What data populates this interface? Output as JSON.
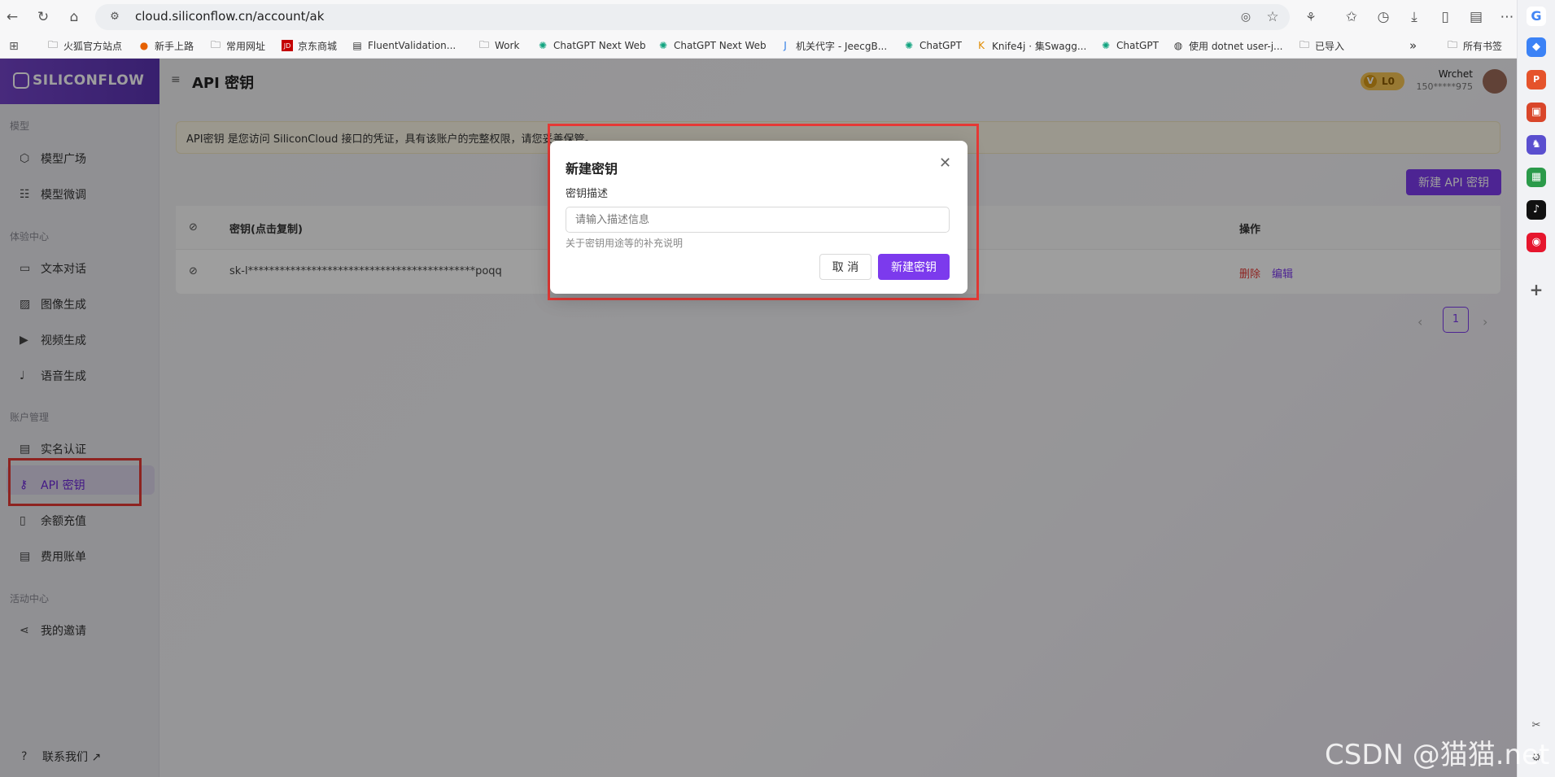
{
  "browser": {
    "url": "cloud.siliconflow.cn/account/ak",
    "bookmarks": [
      "火狐官方站点",
      "新手上路",
      "常用网址",
      "京东商城",
      "FluentValidation...",
      "Work",
      "ChatGPT Next Web",
      "ChatGPT Next Web",
      "机关代字 - JeecgB...",
      "ChatGPT",
      "Knife4j · 集Swagg...",
      "ChatGPT",
      "使用 dotnet user-j...",
      "已导入"
    ],
    "all_bookmarks": "所有书签",
    "more": "»"
  },
  "app": {
    "logo": "SILICONFLOW",
    "page_title": "API 密钥",
    "level_badge": "L0",
    "level_prefix": "V",
    "user_name": "Wrchet",
    "user_phone": "150*****975",
    "notice": "API密钥 是您访问 SiliconCloud 接口的凭证，具有该账户的完整权限，请您妥善保管。",
    "new_key_button": "新建 API 密钥",
    "table": {
      "col_key": "密钥(点击复制)",
      "col_ops": "操作",
      "row_key": "sk-l*******************************************poqq",
      "delete": "删除",
      "edit": "编辑"
    },
    "pagination": {
      "current": "1",
      "prev": "‹",
      "next": "›"
    },
    "sidebar": {
      "groups": [
        {
          "label": "模型",
          "items": [
            {
              "label": "模型广场",
              "icon": "cube-icon"
            },
            {
              "label": "模型微调",
              "icon": "sliders-icon"
            }
          ]
        },
        {
          "label": "体验中心",
          "items": [
            {
              "label": "文本对话",
              "icon": "chat-icon"
            },
            {
              "label": "图像生成",
              "icon": "image-icon"
            },
            {
              "label": "视频生成",
              "icon": "video-icon"
            },
            {
              "label": "语音生成",
              "icon": "mic-icon"
            }
          ]
        },
        {
          "label": "账户管理",
          "items": [
            {
              "label": "实名认证",
              "icon": "idcard-icon"
            },
            {
              "label": "API 密钥",
              "icon": "key-icon"
            },
            {
              "label": "余额充值",
              "icon": "recharge-icon"
            },
            {
              "label": "费用账单",
              "icon": "bill-icon"
            }
          ]
        },
        {
          "label": "活动中心",
          "items": [
            {
              "label": "我的邀请",
              "icon": "share-icon"
            }
          ]
        }
      ],
      "contact": "联系我们 ↗"
    }
  },
  "modal": {
    "title": "新建密钥",
    "field_label": "密钥描述",
    "placeholder": "请输入描述信息",
    "hint": "关于密钥用途等的补充说明",
    "cancel": "取 消",
    "confirm": "新建密钥"
  },
  "watermark": "CSDN @猫猫.net",
  "colors": {
    "accent": "#7c3aed",
    "highlight": "#e53935",
    "notice_bg": "#fbf6e6"
  }
}
